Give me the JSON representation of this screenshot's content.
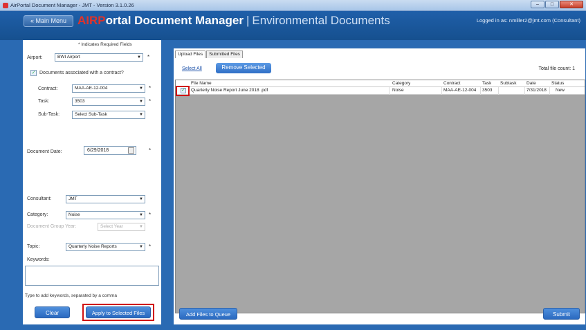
{
  "window": {
    "title": "AirPortal Document Manager - JMT - Version 3.1.0.26"
  },
  "header": {
    "main_menu": "« Main Menu",
    "brand_air": "AIRP",
    "brand_rest": "ortal Document Manager",
    "separator": "|",
    "subtitle": "Environmental Documents",
    "logged_in": "Logged in as: nmiller2@jmt.com (Consultant)"
  },
  "form": {
    "required_note": "* Indicates Required Fields",
    "airport_label": "Airport:",
    "airport_value": "BWI Airport",
    "contract_checkbox_label": "Documents associated with a contract?",
    "contract_label": "Contract:",
    "contract_value": "MAA-AE-12-004",
    "task_label": "Task:",
    "task_value": "3503",
    "subtask_label": "Sub-Task:",
    "subtask_value": "Select Sub-Task",
    "doc_date_label": "Document Date:",
    "doc_date_value": "6/29/2018",
    "consultant_label": "Consultant:",
    "consultant_value": "JMT",
    "category_label": "Category:",
    "category_value": "Noise",
    "group_year_label": "Document Group Year:",
    "group_year_value": "Select Year",
    "topic_label": "Topic:",
    "topic_value": "Quarterly Noise Reports",
    "keywords_label": "Keywords:",
    "keywords_hint": "Type to add keywords, separated by a comma",
    "clear_button": "Clear",
    "apply_button": "Apply to Selected Files",
    "required_mark": "*"
  },
  "upload": {
    "tabs": [
      "Upload Files",
      "Submitted Files"
    ],
    "select_all": "Select All",
    "remove_selected": "Remove Selected",
    "total_file_count": "Total file count: 1",
    "columns": [
      "File Name",
      "Category",
      "Contract",
      "Task",
      "Subtask",
      "Date",
      "Status"
    ],
    "rows": [
      {
        "file_name": "Quarterly Noise Report June 2018 .pdf",
        "category": "Noise",
        "contract": "MAA-AE-12-004",
        "task": "3503",
        "subtask": "",
        "date": "7/31/2018",
        "status": "New",
        "checked": true
      }
    ],
    "add_files_button": "Add Files to Queue",
    "submit_button": "Submit"
  },
  "colors": {
    "header_blue": "#1f5fa9",
    "button_blue": "#2a69c0",
    "highlight_red": "#d01010",
    "brand_red": "#e0332a"
  }
}
